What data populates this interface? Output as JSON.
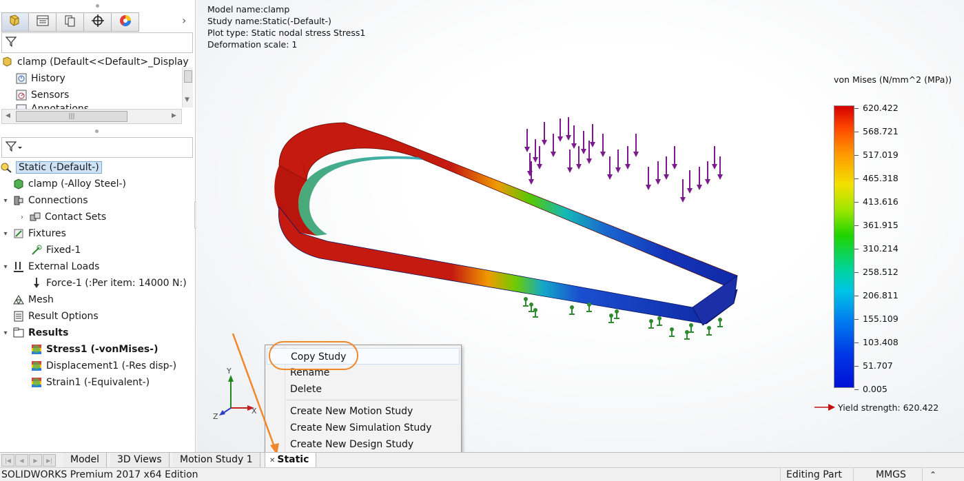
{
  "panel_tabs": [
    {
      "icon": "feature-manager-icon"
    },
    {
      "icon": "property-manager-icon"
    },
    {
      "icon": "configuration-manager-icon"
    },
    {
      "icon": "dimxpert-icon"
    },
    {
      "icon": "display-manager-icon"
    }
  ],
  "feature_tree": {
    "root": "clamp  (Default<<Default>_Display",
    "items": [
      "History",
      "Sensors",
      "Annotations"
    ]
  },
  "simulation_tree": {
    "study": "Static (-Default-)",
    "items": [
      {
        "label": "clamp (-Alloy Steel-)",
        "expander": "",
        "indent": 1
      },
      {
        "label": "Connections",
        "expander": "▾",
        "indent": 1
      },
      {
        "label": "Contact Sets",
        "expander": "›",
        "indent": 2
      },
      {
        "label": "Fixtures",
        "expander": "▾",
        "indent": 1
      },
      {
        "label": "Fixed-1",
        "expander": "",
        "indent": 2
      },
      {
        "label": "External Loads",
        "expander": "▾",
        "indent": 1
      },
      {
        "label": "Force-1 (:Per item: 14000 N:)",
        "expander": "",
        "indent": 2
      },
      {
        "label": "Mesh",
        "expander": "",
        "indent": 1
      },
      {
        "label": "Result Options",
        "expander": "",
        "indent": 1
      },
      {
        "label": "Results",
        "expander": "▾",
        "indent": 1,
        "bold": true
      },
      {
        "label": "Stress1 (-vonMises-)",
        "expander": "",
        "indent": 2,
        "bold": true
      },
      {
        "label": "Displacement1 (-Res disp-)",
        "expander": "",
        "indent": 2
      },
      {
        "label": "Strain1 (-Equivalent-)",
        "expander": "",
        "indent": 2
      }
    ]
  },
  "plot_info": {
    "model_name": "Model name:clamp",
    "study_name": "Study name:Static(-Default-)",
    "plot_type": "Plot type: Static nodal stress Stress1",
    "deformation": "Deformation scale: 1"
  },
  "legend": {
    "title": "von Mises (N/mm^2 (MPa))",
    "ticks": [
      "620.422",
      "568.721",
      "517.019",
      "465.318",
      "413.616",
      "361.915",
      "310.214",
      "258.512",
      "206.811",
      "155.109",
      "103.408",
      "51.707",
      "0.005"
    ],
    "yield_label": "Yield strength: 620.422",
    "yield_color": "#c01010"
  },
  "triad": {
    "x": "X",
    "y": "Y",
    "z": "Z"
  },
  "context_menu": {
    "items": [
      "Copy Study",
      "Rename",
      "Delete",
      "Create New Motion Study",
      "Create New Simulation Study",
      "Create New Design Study"
    ],
    "highlight_color": "#f0872b"
  },
  "bottom_tabs": [
    "Model",
    "3D Views",
    "Motion Study 1",
    "Static"
  ],
  "status_bar": {
    "edition": "SOLIDWORKS Premium 2017 x64 Edition",
    "mode": "Editing Part",
    "units": "MMGS",
    "menu": "⌃"
  },
  "colors": {
    "selection_bg": "#cfe3f7",
    "load_arrow": "#7a1a8c",
    "fixture": "#2f8a2f"
  }
}
